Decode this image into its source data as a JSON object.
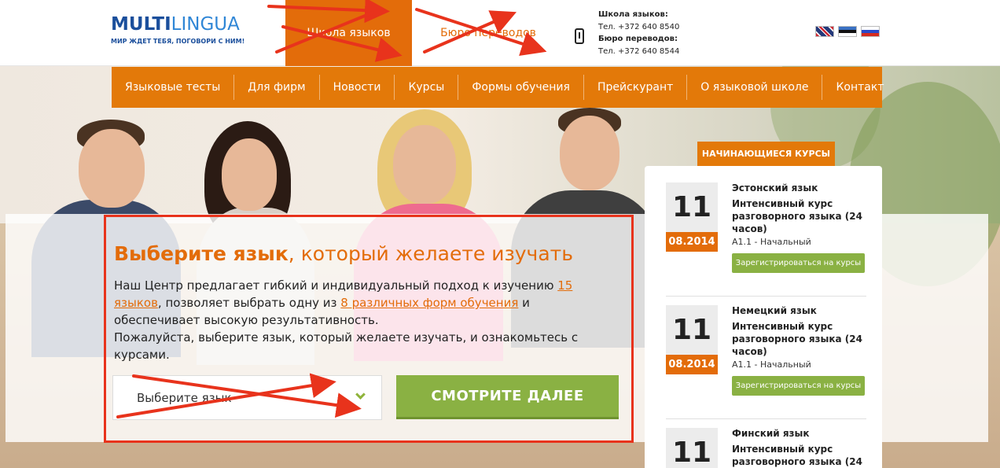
{
  "header": {
    "logo_name_a": "MULTI",
    "logo_name_b": "LINGUA",
    "logo_tagline": "МИР ЖДЕТ ТЕБЯ, ПОГОВОРИ С НИМ!",
    "tab_school": "Школа языков",
    "tab_bureau": "Бюро переводов",
    "contacts": {
      "school_label": "Школа языков:",
      "school_phone": "Тел. +372 640 8540",
      "bureau_label": "Бюро переводов:",
      "bureau_phone": "Тел. +372 640 8544"
    },
    "flags": [
      "english-flag",
      "estonian-flag",
      "russian-flag"
    ]
  },
  "nav": {
    "items": [
      "Языковые тесты",
      "Для фирм",
      "Новости",
      "Курсы",
      "Формы обучения",
      "Прейскурант",
      "О языковой школе",
      "Контакт"
    ]
  },
  "promo": {
    "title_bold": "Выберите язык",
    "title_rest": ", который желаете изучать",
    "text_1": "Наш Центр предлагает гибкий и индивидуальный подход к изучению ",
    "link_1": "15 языков",
    "text_2": ", позволяет выбрать одну из ",
    "link_2": "8 различных форм обучения",
    "text_3": " и обеспечивает высокую результативность.",
    "text_4": "Пожалуйста, выберите язык, который желаете изучать, и ознакомьтесь с курсами.",
    "select_value": "Выберите язык",
    "more_button": "СМОТРИТЕ ДАЛЕЕ"
  },
  "courses": {
    "tab_label": "НАЧИНАЮЩИЕСЯ КУРСЫ",
    "items": [
      {
        "day": "11",
        "month": "08.2014",
        "language": "Эстонский язык",
        "name": "Интенсивный курс разговорного языка (24 часов)",
        "level": "A1.1 - Начальный",
        "button": "Зарегистрироваться на курсы"
      },
      {
        "day": "11",
        "month": "08.2014",
        "language": "Немецкий язык",
        "name": "Интенсивный курс разговорного языка (24 часов)",
        "level": "A1.1 - Начальный",
        "button": "Зарегистрироваться на курсы"
      },
      {
        "day": "11",
        "month": "",
        "language": "Финский язык",
        "name": "Интенсивный курс разговорного языка (24",
        "level": "",
        "button": ""
      }
    ]
  },
  "colors": {
    "accent_orange": "#e36c0a",
    "nav_orange": "#e37909",
    "button_green": "#8ab143",
    "annotation_red": "#e8331c",
    "brand_blue": "#1b4f9c"
  }
}
